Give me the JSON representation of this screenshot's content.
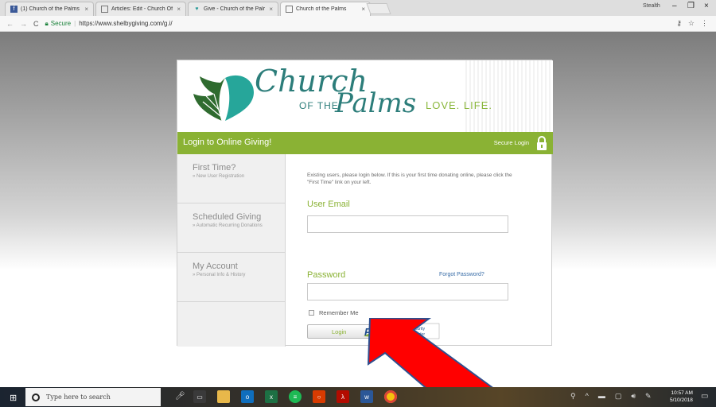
{
  "browser": {
    "tabs": [
      {
        "title": "(1) Church of the Palms",
        "icon": "facebook-icon",
        "active": false
      },
      {
        "title": "Articles: Edit - Church Of",
        "icon": "page-icon",
        "active": false
      },
      {
        "title": "Give - Church of the Palr",
        "icon": "heart-icon",
        "active": false
      },
      {
        "title": "Church of the Palms",
        "icon": "page-icon",
        "active": true
      }
    ],
    "user_label": "Stealth",
    "secure_label": "Secure",
    "url": "https://www.shelbygiving.com/g.i/"
  },
  "logo": {
    "church": "Church",
    "of_the": "OF THE",
    "palms": "Palms",
    "tagline": "LOVE. LIFE."
  },
  "header": {
    "title": "Login to Online Giving!",
    "secure_login": "Secure Login"
  },
  "sidebar": {
    "items": [
      {
        "title": "First Time?",
        "sub": "» New User Registration"
      },
      {
        "title": "Scheduled Giving",
        "sub": "» Automatic Recurring Donations"
      },
      {
        "title": "My Account",
        "sub": "» Personal Info & History"
      }
    ]
  },
  "form": {
    "intro": "Existing users, please login below. If this is your first time donating online, please click the \"First Time\" link on your left.",
    "email_label": "User Email",
    "email_value": "",
    "password_label": "Password",
    "password_value": "",
    "forgot_label": "Forgot Password?",
    "remember_label": "Remember Me",
    "remember_checked": false,
    "login_label": "Login"
  },
  "pci": {
    "mark": "PCI",
    "line1": "Level 1 - Security",
    "line2": "Certified Provider"
  },
  "taskbar": {
    "search_placeholder": "Type here to search",
    "time": "10:57 AM",
    "date": "5/10/2018"
  },
  "colors": {
    "brand_green": "#8ab234",
    "brand_teal": "#2c7d7a",
    "arrow_red": "#ff0000"
  }
}
